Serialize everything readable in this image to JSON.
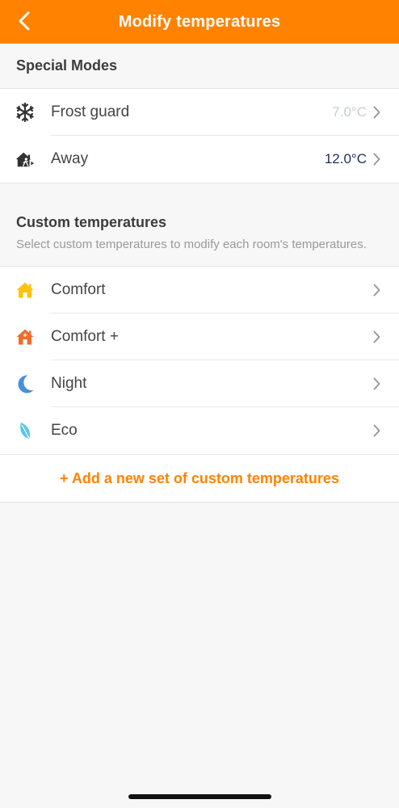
{
  "header": {
    "title": "Modify temperatures",
    "background": "#ff8200"
  },
  "special_modes": {
    "title": "Special Modes",
    "items": [
      {
        "label": "Frost guard",
        "value": "7.0°C",
        "value_color": "#c8ccd4",
        "icon": "snowflake-icon"
      },
      {
        "label": "Away",
        "value": "12.0°C",
        "value_color": "#1f2d5c",
        "icon": "away-house-icon"
      }
    ]
  },
  "custom": {
    "title": "Custom temperatures",
    "description": "Select custom temperatures to modify each room's temperatures.",
    "items": [
      {
        "label": "Comfort",
        "icon": "home-yellow-icon",
        "color": "#ffc20e"
      },
      {
        "label": "Comfort +",
        "icon": "home-orange-icon",
        "color": "#ef6c2b"
      },
      {
        "label": "Night",
        "icon": "moon-icon",
        "color": "#4a90d9"
      },
      {
        "label": "Eco",
        "icon": "leaf-icon",
        "color": "#5bc5e6"
      }
    ],
    "add_label": "+ Add a new set of custom temperatures"
  },
  "accent": "#ff8200"
}
